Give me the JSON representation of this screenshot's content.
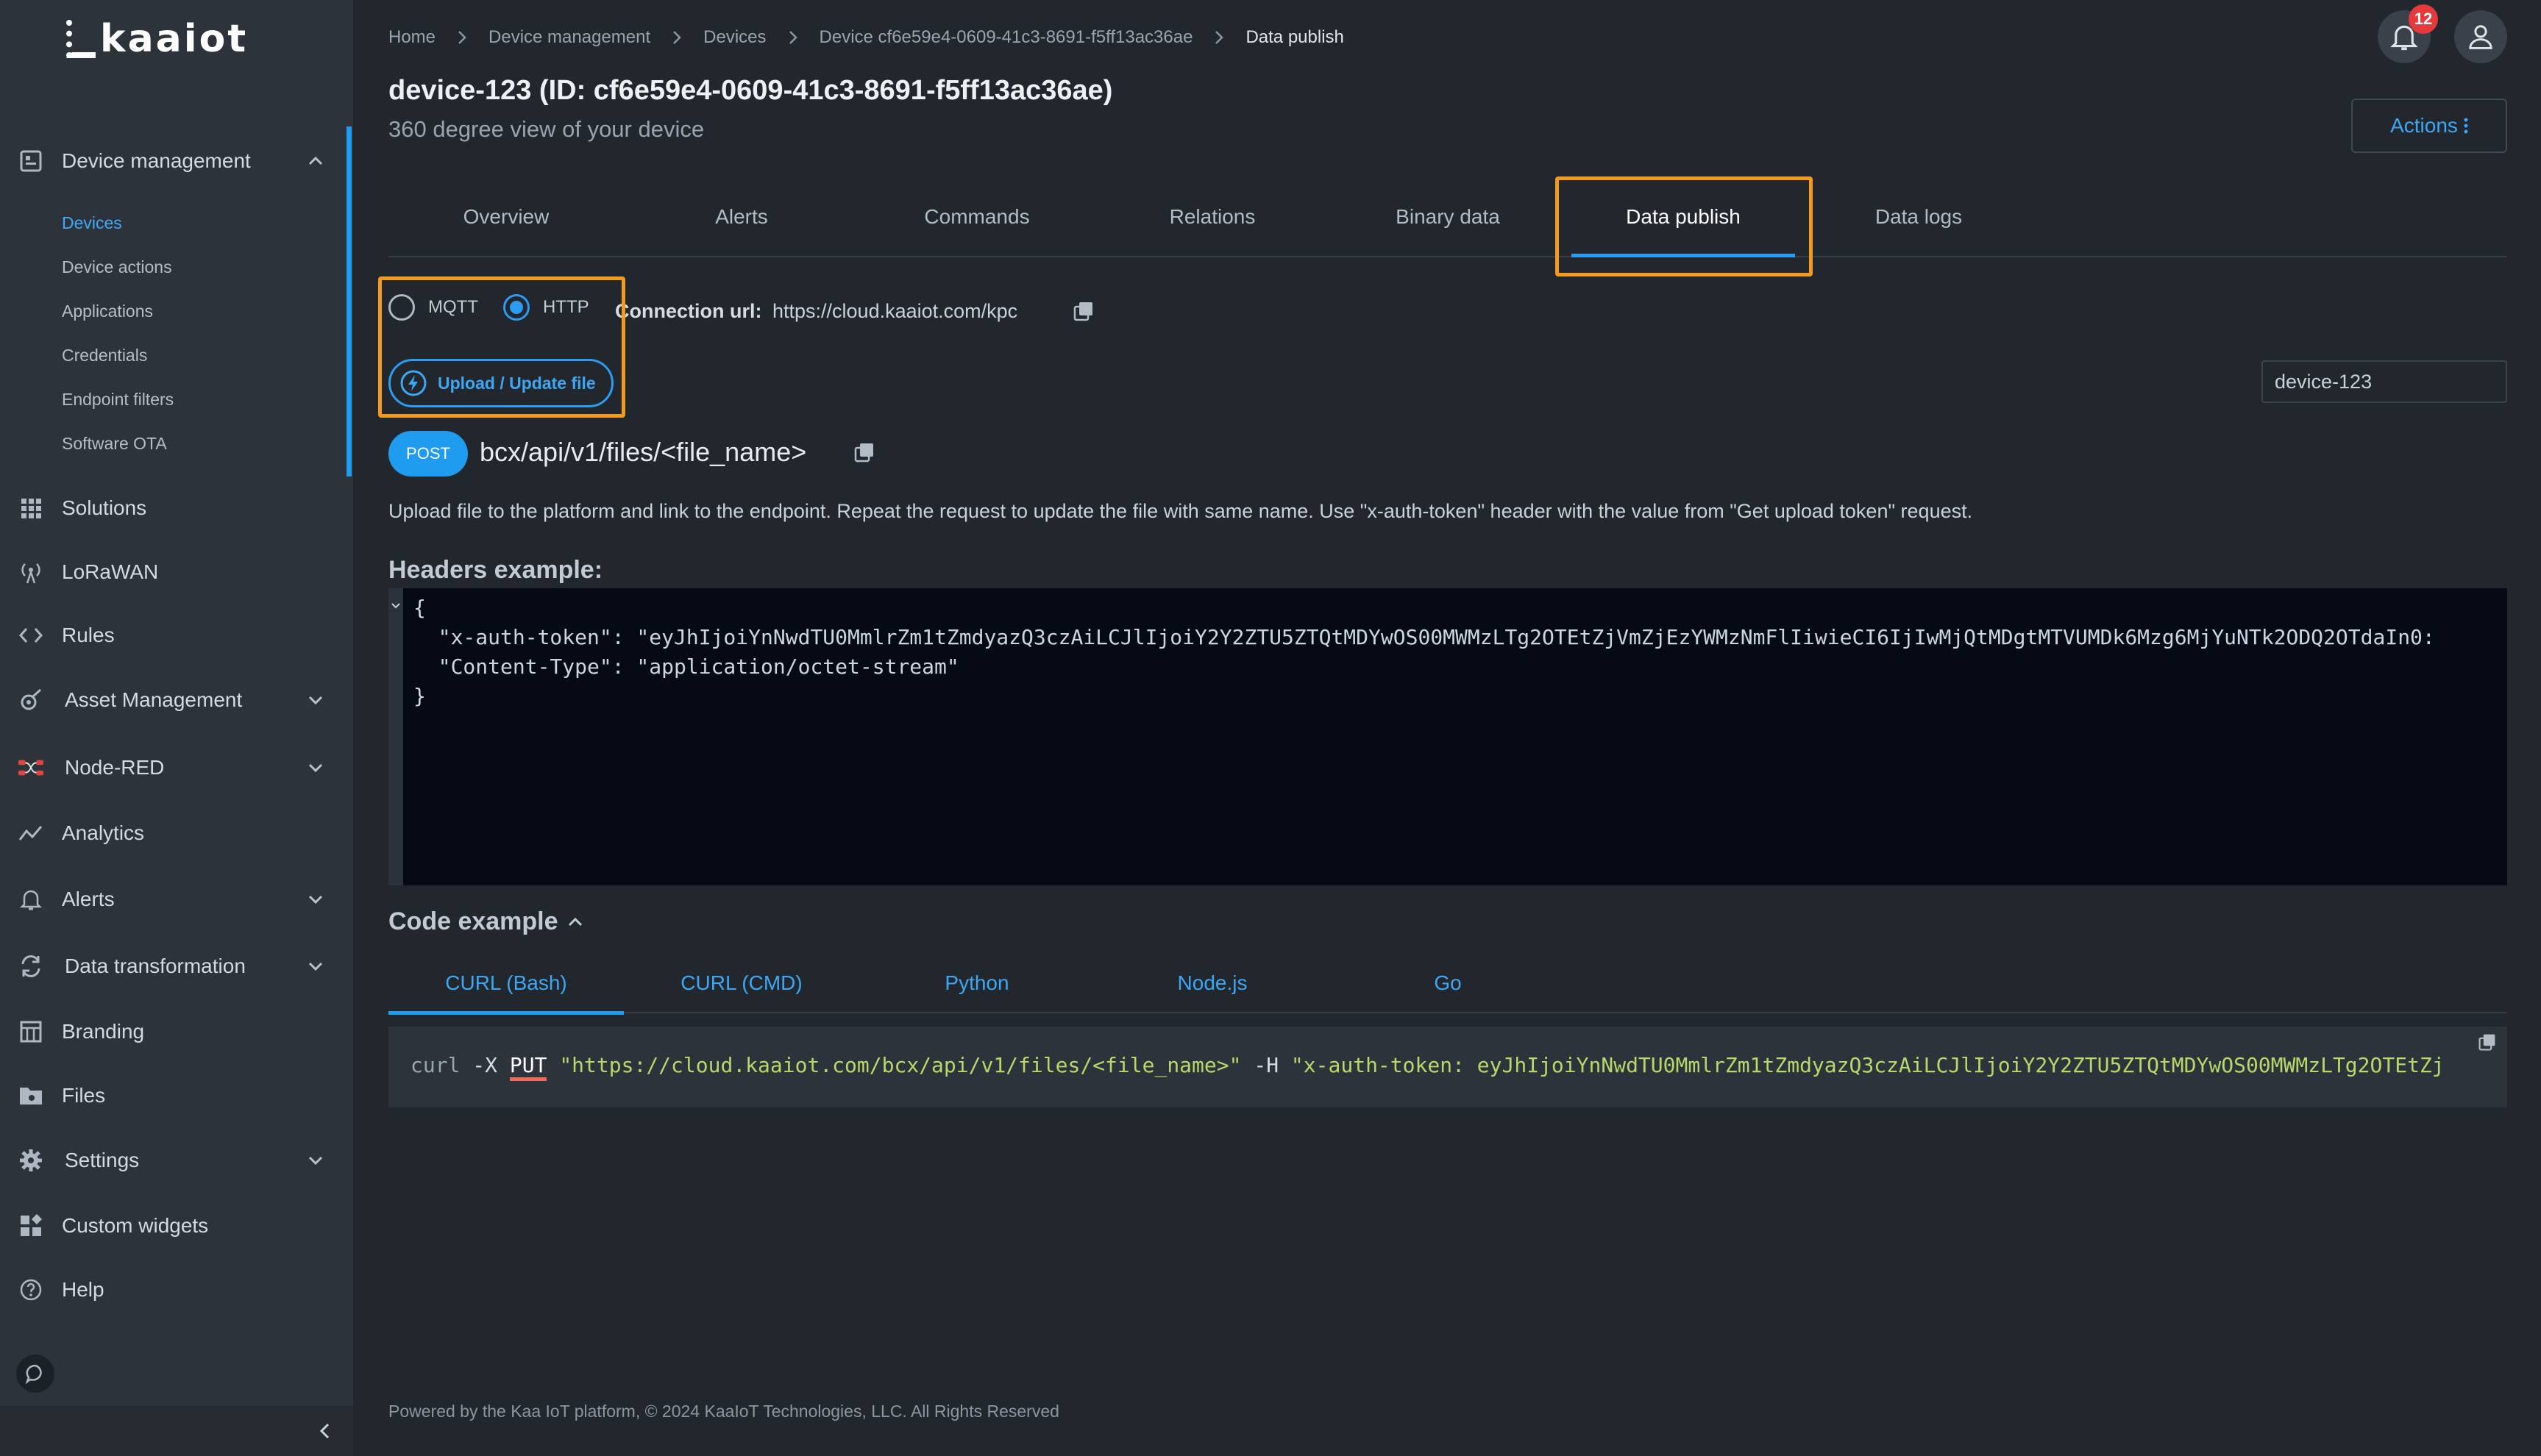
{
  "brand": {
    "logo_text": "kaaiot"
  },
  "sidebar": {
    "items": [
      {
        "label": "Device management",
        "icon": "device-management-icon",
        "expanded": true
      },
      {
        "label": "Solutions",
        "icon": "grid-icon"
      },
      {
        "label": "LoRaWAN",
        "icon": "antenna-icon"
      },
      {
        "label": "Rules",
        "icon": "code-icon"
      },
      {
        "label": "Asset Management",
        "icon": "asset-icon"
      },
      {
        "label": "Node-RED",
        "icon": "node-red-icon"
      },
      {
        "label": "Analytics",
        "icon": "analytics-icon"
      },
      {
        "label": "Alerts",
        "icon": "bell-icon"
      },
      {
        "label": "Data transformation",
        "icon": "transform-icon"
      },
      {
        "label": "Branding",
        "icon": "branding-icon"
      },
      {
        "label": "Files",
        "icon": "folder-icon"
      },
      {
        "label": "Settings",
        "icon": "gear-icon"
      },
      {
        "label": "Custom widgets",
        "icon": "widgets-icon"
      },
      {
        "label": "Help",
        "icon": "help-icon"
      }
    ],
    "sub_items": [
      "Devices",
      "Device actions",
      "Applications",
      "Credentials",
      "Endpoint filters",
      "Software OTA"
    ],
    "active_sub_item": "Devices"
  },
  "breadcrumb": [
    "Home",
    "Device management",
    "Devices",
    "Device cf6e59e4-0609-41c3-8691-f5ff13ac36ae",
    "Data publish"
  ],
  "header": {
    "notification_count": "12",
    "title": "device-123 (ID: cf6e59e4-0609-41c3-8691-f5ff13ac36ae)",
    "subtitle": "360 degree view of your device",
    "actions_label": "Actions"
  },
  "tabs": [
    "Overview",
    "Alerts",
    "Commands",
    "Relations",
    "Binary data",
    "Data publish",
    "Data logs"
  ],
  "active_tab": "Data publish",
  "protocol": {
    "options": [
      "MQTT",
      "HTTP"
    ],
    "selected": "HTTP"
  },
  "connection": {
    "label": "Connection url:",
    "url": "https://cloud.kaaiot.com/kpc"
  },
  "upload_button_label": "Upload / Update file",
  "device_select_value": "device-123",
  "request": {
    "method": "POST",
    "endpoint": "bcx/api/v1/files/<file_name>",
    "description": "Upload file to the platform and link to the endpoint. Repeat the request to update the file with same name. Use \"x-auth-token\" header with the value from \"Get upload token\" request."
  },
  "headers_example": {
    "title": "Headers example:",
    "lines": [
      "{",
      "  \"x-auth-token\": \"eyJhIjoiYnNwdTU0MmlrZm1tZmdyazQ3czAiLCJlIjoiY2Y2ZTU5ZTQtMDYwOS00MWMzLTg2OTEtZjVmZjEzYWMzNmFlIiwieCI6IjIwMjQtMDgtMTVUMDk6Mzg6MjYuNTk2ODQ2OTdaIn0:",
      "  \"Content-Type\": \"application/octet-stream\"",
      "}"
    ]
  },
  "code_example": {
    "title": "Code example",
    "tabs": [
      "CURL (Bash)",
      "CURL (CMD)",
      "Python",
      "Node.js",
      "Go"
    ],
    "active_tab": "CURL (Bash)",
    "curl_cmd": "curl",
    "curl_flag": "-X",
    "curl_method": "PUT",
    "curl_url": "\"https://cloud.kaaiot.com/bcx/api/v1/files/<file_name>\"",
    "curl_header_flag": "-H",
    "curl_header": "\"x-auth-token: eyJhIjoiYnNwdTU0MmlrZm1tZmdyazQ3czAiLCJlIjoiY2Y2ZTU5ZTQtMDYwOS00MWMzLTg2OTEtZj"
  },
  "footer": "Powered by the Kaa IoT platform, © 2024 KaaIoT Technologies, LLC. All Rights Reserved",
  "colors": {
    "accent": "#1f9bf0",
    "highlight": "#f29b1c",
    "badge": "#e5393b",
    "sidebar": "#2d333b",
    "background": "#22272e"
  }
}
